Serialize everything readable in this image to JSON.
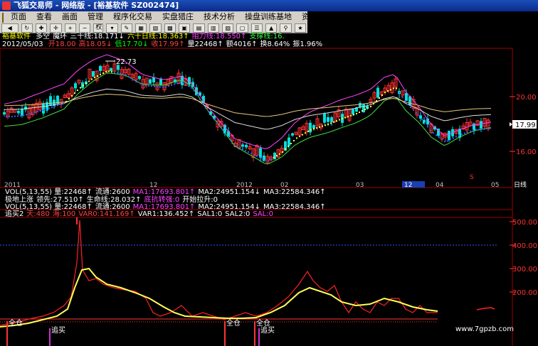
{
  "window": {
    "title": "飞狐交易师 - 网络版 - [裕基软件 SZ002474]"
  },
  "menu": [
    "页面",
    "查看",
    "画面",
    "管理",
    "程序化交易",
    "实盘猎庄",
    "技术分析",
    "操盘训练基地",
    "资"
  ],
  "toolbar": {
    "quan_label": "权"
  },
  "info_line1": {
    "name": "裕基软件",
    "items": [
      {
        "text": "多空",
        "color": "#ffffff"
      },
      {
        "text": "魔环",
        "color": "#ffffff"
      },
      {
        "text": "三十线:18.171↓",
        "color": "#ffffff"
      },
      {
        "text": "六十日线:18.363↑",
        "color": "#ffff00"
      },
      {
        "text": "阻力线:18.550↑",
        "color": "#ff44ff"
      },
      {
        "text": "支撑线:16.",
        "color": "#44ff44"
      }
    ]
  },
  "info_line2": {
    "date": "2012/05/03",
    "items": [
      {
        "text": "开18.00",
        "color": "#ff4444"
      },
      {
        "text": "高18.05↓",
        "color": "#ff4444"
      },
      {
        "text": "低17.70↓",
        "color": "#00ff00"
      },
      {
        "text": "收17.99↑",
        "color": "#ff4444"
      },
      {
        "text": "量22468↑",
        "color": "#ffffff"
      },
      {
        "text": "额4016↑",
        "color": "#ffffff"
      },
      {
        "text": "换8.64%",
        "color": "#ffffff"
      },
      {
        "text": "振1.96%",
        "color": "#ffffff"
      }
    ]
  },
  "price_chart": {
    "annotation_high": "22.73",
    "price_tag": "17.99",
    "right_axis": [
      "20.00",
      "16.00"
    ],
    "x_labels": [
      "2011",
      "12",
      "2012",
      "02",
      "03",
      "04",
      "05"
    ],
    "x_label_12_highlight": "12",
    "x_corner": "日线",
    "pdot": "S"
  },
  "vol_line1": {
    "items": [
      {
        "text": "VOL(5,13,55) 量:22468↑",
        "color": "#ffffff"
      },
      {
        "text": "流通:2600",
        "color": "#ffffff"
      },
      {
        "text": "MA1:17693.801↑",
        "color": "#ff44ff"
      },
      {
        "text": "MA2:24951.154↓",
        "color": "#ffffff"
      },
      {
        "text": "MA3:22584.346↑",
        "color": "#ffffff"
      }
    ]
  },
  "indicator_line": {
    "items": [
      {
        "text": "极地上涨",
        "color": "#ffffff"
      },
      {
        "text": "领先:27.510↑",
        "color": "#ffffff"
      },
      {
        "text": "生命线:28.032↑",
        "color": "#ffffff"
      },
      {
        "text": "底抗转强:0",
        "color": "#ff44ff"
      },
      {
        "text": "开始拉升:0",
        "color": "#ffffff"
      }
    ]
  },
  "vol_line2": {
    "items": [
      {
        "text": "VOL(5,13,55) 量:22468↑",
        "color": "#ffffff"
      },
      {
        "text": "流通:2600",
        "color": "#ffffff"
      },
      {
        "text": "MA1:17693.801↑",
        "color": "#ff44ff"
      },
      {
        "text": "MA2:24951.154↓",
        "color": "#ffffff"
      },
      {
        "text": "MA3:22584.346↑",
        "color": "#ffffff"
      }
    ]
  },
  "zhuimai_line": {
    "items": [
      {
        "text": "追买2",
        "color": "#ffffff"
      },
      {
        "text": "天:480",
        "color": "#ff4444"
      },
      {
        "text": "海:100",
        "color": "#ff4444"
      },
      {
        "text": "VAR0:141.169↑",
        "color": "#ff4444"
      },
      {
        "text": "VAR1:136.452↑",
        "color": "#ffffff"
      },
      {
        "text": "SAL1:0",
        "color": "#ffffff"
      },
      {
        "text": "SAL2:0",
        "color": "#ffffff"
      },
      {
        "text": "SAL:0",
        "color": "#ff44ff"
      }
    ]
  },
  "lower_chart": {
    "right_axis": [
      "500.00",
      "400.00",
      "300.00",
      "200.00"
    ],
    "labels": [
      {
        "text": "全仓",
        "color": "#ffffff"
      },
      {
        "text": "追买",
        "color": "#ffffff"
      },
      {
        "text": "全仓",
        "color": "#ffffff"
      },
      {
        "text": "全仓",
        "color": "#ffffff"
      },
      {
        "text": "追买",
        "color": "#ffffff"
      }
    ]
  },
  "watermark": "www.7gpzb.com"
}
